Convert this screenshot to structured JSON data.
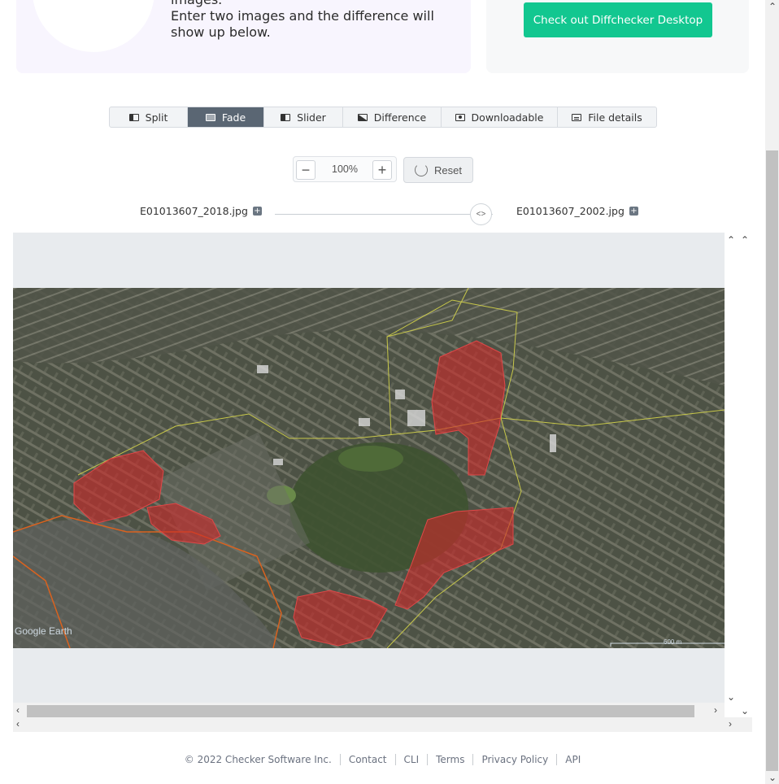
{
  "intro": {
    "line1": "images.",
    "line2": "Enter two images and the difference will show up below."
  },
  "cta": {
    "label": "Check out Diffchecker Desktop",
    "color": "#12c790"
  },
  "tabs": [
    {
      "label": "Split",
      "icon": "split-icon",
      "active": false
    },
    {
      "label": "Fade",
      "icon": "fade-icon",
      "active": true
    },
    {
      "label": "Slider",
      "icon": "slider-icon",
      "active": false
    },
    {
      "label": "Difference",
      "icon": "difference-icon",
      "active": false
    },
    {
      "label": "Downloadable",
      "icon": "download-icon",
      "active": false
    },
    {
      "label": "File details",
      "icon": "file-details-icon",
      "active": false
    }
  ],
  "zoom": {
    "value": "100%",
    "minus": "−",
    "plus": "+",
    "reset_label": "Reset"
  },
  "files": {
    "left": "E01013607_2018.jpg",
    "right": "E01013607_2002.jpg",
    "fade_position": 0.94
  },
  "map": {
    "watermark": "Google Earth",
    "scale_label": "600 m"
  },
  "footer": {
    "copyright": "© 2022 Checker Software Inc.",
    "links": [
      "Contact",
      "CLI",
      "Terms",
      "Privacy Policy",
      "API"
    ]
  }
}
